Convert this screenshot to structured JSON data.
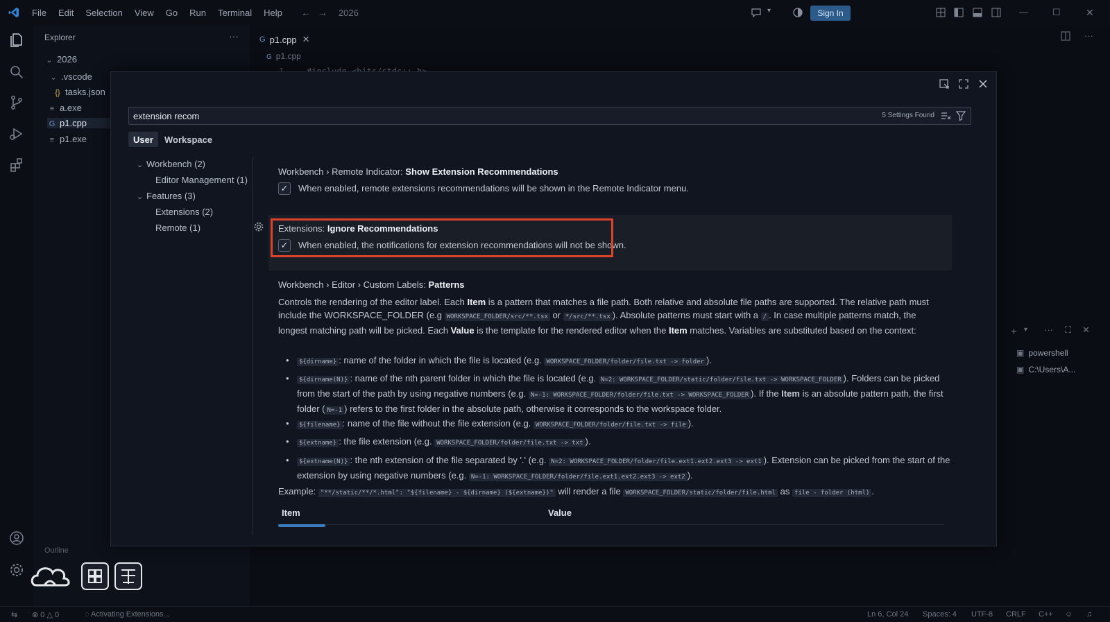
{
  "window": {
    "menu": [
      "File",
      "Edit",
      "Selection",
      "View",
      "Go",
      "Run",
      "Terminal",
      "Help"
    ],
    "title": "2026",
    "sign_in": "Sign In"
  },
  "explorer": {
    "header": "Explorer",
    "root": "2026",
    "items": [
      {
        "label": ".vscode",
        "icon": "chevron-down-icon"
      },
      {
        "label": "tasks.json",
        "icon": "json-braces-icon"
      },
      {
        "label": "a.exe",
        "icon": "file-lines-icon"
      },
      {
        "label": "p1.cpp",
        "icon": "cpp-file-icon"
      },
      {
        "label": "p1.exe",
        "icon": "file-lines-icon"
      }
    ]
  },
  "editor": {
    "tab_label": "p1.cpp",
    "breadcrumb": "p1.cpp",
    "code_line_number": "1",
    "code_line_text": "#include <bits/stdc++.h>"
  },
  "terminal_panel": {
    "items": [
      "powershell",
      "C:\\Users\\A..."
    ]
  },
  "settings": {
    "search_value": "extension recom",
    "settings_found": "5 Settings Found",
    "scopes": [
      "User",
      "Workspace"
    ],
    "toc": [
      {
        "label": "Workbench (2)",
        "level": 0
      },
      {
        "label": "Editor Management (1)",
        "level": 1
      },
      {
        "label": "Features (3)",
        "level": 0
      },
      {
        "label": "Extensions (2)",
        "level": 1
      },
      {
        "label": "Remote (1)",
        "level": 1
      }
    ],
    "s1": {
      "category": "Workbench › Remote Indicator: ",
      "name": "Show Extension Recommendations",
      "description": "When enabled, remote extensions recommendations will be shown in the Remote Indicator menu.",
      "checked": true
    },
    "s2": {
      "category": "Extensions: ",
      "name": "Ignore Recommendations",
      "description": "When enabled, the notifications for extension recommendations will not be shown.",
      "checked": true
    },
    "s3": {
      "category": "Workbench › Editor › Custom Labels: ",
      "name": "Patterns",
      "table_item": "Item",
      "table_value": "Value"
    }
  },
  "statusbar": {
    "errors": "0",
    "warnings": "0",
    "activity": "Activating Extensions...",
    "position": "Ln 6, Col 24",
    "spaces": "Spaces: 4",
    "encoding": "UTF-8",
    "eol": "CRLF",
    "language": "C++"
  },
  "accent": "#2c5a8a",
  "highlight_color": "#e0412b"
}
